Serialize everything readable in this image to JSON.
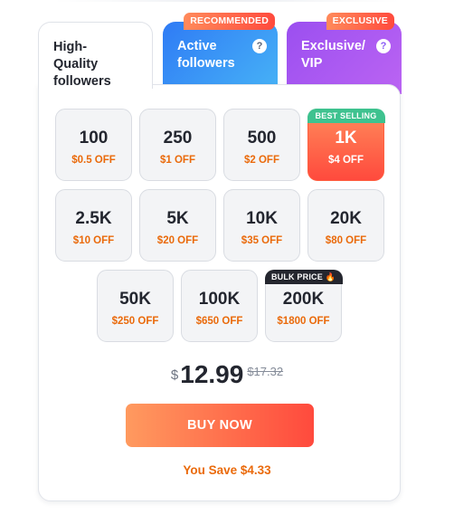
{
  "tabs": [
    {
      "label": "High-Quality followers",
      "badge": "",
      "help": ""
    },
    {
      "label": "Active followers",
      "badge": "RECOMMENDED",
      "help": "?"
    },
    {
      "label": "Exclusive/ VIP",
      "badge": "EXCLUSIVE",
      "help": "?"
    }
  ],
  "options": [
    {
      "qty": "100",
      "discount": "$0.5 OFF",
      "badge": ""
    },
    {
      "qty": "250",
      "discount": "$1 OFF",
      "badge": ""
    },
    {
      "qty": "500",
      "discount": "$2 OFF",
      "badge": ""
    },
    {
      "qty": "1K",
      "discount": "$4 OFF",
      "badge": "BEST SELLING",
      "selected": true
    },
    {
      "qty": "2.5K",
      "discount": "$10 OFF",
      "badge": ""
    },
    {
      "qty": "5K",
      "discount": "$20 OFF",
      "badge": ""
    },
    {
      "qty": "10K",
      "discount": "$35 OFF",
      "badge": ""
    },
    {
      "qty": "20K",
      "discount": "$80 OFF",
      "badge": ""
    },
    {
      "qty": "50K",
      "discount": "$250 OFF",
      "badge": ""
    },
    {
      "qty": "100K",
      "discount": "$650 OFF",
      "badge": ""
    },
    {
      "qty": "200K",
      "discount": "$1800 OFF",
      "badge": "BULK PRICE",
      "badge_icon": "fire-icon"
    }
  ],
  "price": {
    "currency": "$",
    "current": "12.99",
    "original": "$17.32"
  },
  "buy_button": {
    "label": "BUY NOW"
  },
  "savings": {
    "text": "You Save $4.33"
  },
  "colors": {
    "accent_orange": "#ff4a3d",
    "discount_text": "#ea6a0b",
    "tab_active_blue": "#2f7bf5",
    "tab_vip_purple": "#9b4ff0",
    "badge_green": "#3ec28f"
  }
}
